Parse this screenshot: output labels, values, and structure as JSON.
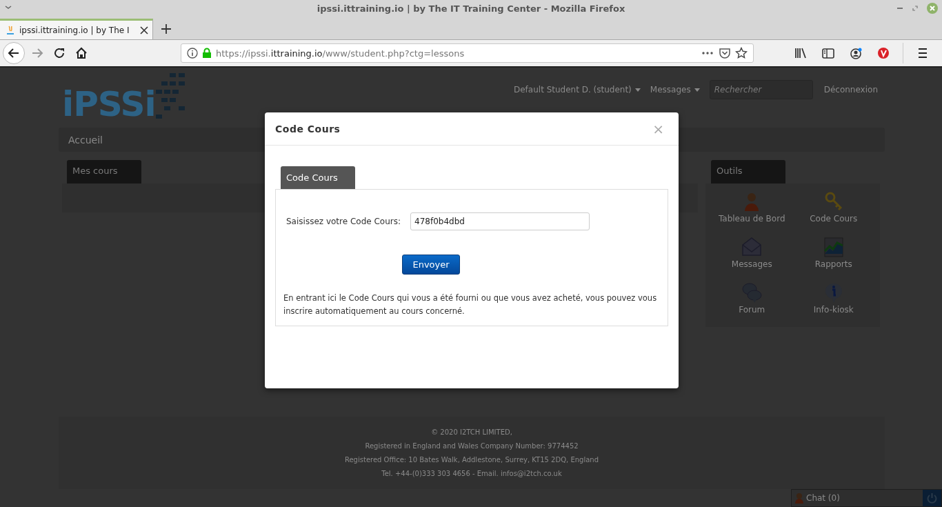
{
  "window": {
    "title": "ipssi.ittraining.io | by The IT Training Center - Mozilla Firefox"
  },
  "browser": {
    "tabs": [
      {
        "title": "ipssi.ittraining.io | by The I",
        "selected": true
      }
    ],
    "url": {
      "start": "https://ipssi.",
      "domain": "ittraining.io",
      "rest": "/www/student.php?ctg=lessons"
    }
  },
  "site": {
    "logo": "iPSSi",
    "user_menu": "Default Student D. (student)",
    "messages_menu": "Messages",
    "search": {
      "placeholder": "Rechercher"
    },
    "logout": "Déconnexion",
    "breadcrumb": "Accueil",
    "courses_tab": "Mes cours",
    "tools": {
      "title": "Outils",
      "items": [
        {
          "label": "Tableau de Bord",
          "kind": "person"
        },
        {
          "label": "Code Cours",
          "kind": "key"
        },
        {
          "label": "Messages",
          "kind": "envelope"
        },
        {
          "label": "Rapports",
          "kind": "chart"
        },
        {
          "label": "Forum",
          "kind": "bubbles"
        },
        {
          "label": "Info-kiosk",
          "kind": "info"
        }
      ]
    },
    "footer": [
      "© 2020 I2TCH LIMITED,",
      "Registered in England and Wales Company Number: 9774452",
      "Registered Office: 10 Bates Walk, Addlestone, Surrey, KT15 2DQ, England",
      "Tel. +44-(0)333 303 4656 - Email. infos@i2tch.co.uk"
    ],
    "chat": {
      "label": "Chat (0)"
    }
  },
  "modal": {
    "title": "Code Cours",
    "close": "×",
    "tabs": [
      {
        "label": "Code Cours",
        "selected": true
      }
    ],
    "field_label": "Saisissez votre Code Cours:",
    "field_value": "478f0b4dbd",
    "submit": "Envoyer",
    "help": "En entrant ici le Code Cours qui vous a été fourni ou que vous avez acheté, vous pouvez vous inscrire automatiquement au cours concerné."
  }
}
